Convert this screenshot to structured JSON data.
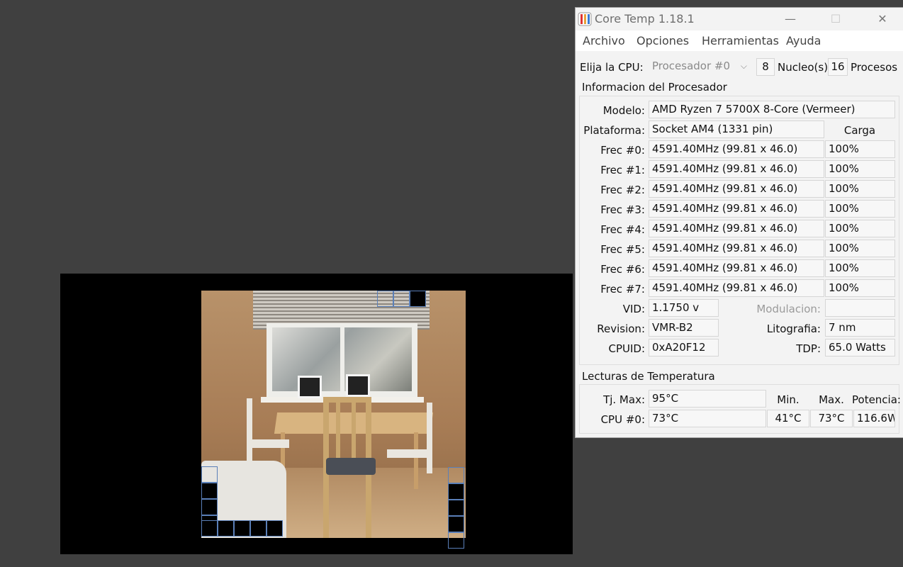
{
  "core_temp": {
    "title": "Core Temp 1.18.1",
    "window_controls": {
      "minimize": "—",
      "maximize": "☐",
      "close": "✕"
    },
    "menu": [
      "Archivo",
      "Opciones",
      "Herramientas",
      "Ayuda"
    ],
    "cpu_select": {
      "label": "Elija la CPU:",
      "selected": "Procesador #0",
      "cores_value": "8",
      "cores_label": "Nucleo(s)",
      "threads_value": "16",
      "threads_label": "Procesos"
    },
    "processor_info": {
      "section_title": "Informacion del Procesador",
      "model_label": "Modelo:",
      "model_value": "AMD Ryzen 7 5700X 8-Core (Vermeer)",
      "platform_label": "Plataforma:",
      "platform_value": "Socket AM4 (1331 pin)",
      "load_header": "Carga",
      "frequencies": [
        {
          "label": "Frec #0:",
          "value": "4591.40MHz (99.81 x 46.0)",
          "load": "100%"
        },
        {
          "label": "Frec #1:",
          "value": "4591.40MHz (99.81 x 46.0)",
          "load": "100%"
        },
        {
          "label": "Frec #2:",
          "value": "4591.40MHz (99.81 x 46.0)",
          "load": "100%"
        },
        {
          "label": "Frec #3:",
          "value": "4591.40MHz (99.81 x 46.0)",
          "load": "100%"
        },
        {
          "label": "Frec #4:",
          "value": "4591.40MHz (99.81 x 46.0)",
          "load": "100%"
        },
        {
          "label": "Frec #5:",
          "value": "4591.40MHz (99.81 x 46.0)",
          "load": "100%"
        },
        {
          "label": "Frec #6:",
          "value": "4591.40MHz (99.81 x 46.0)",
          "load": "100%"
        },
        {
          "label": "Frec #7:",
          "value": "4591.40MHz (99.81 x 46.0)",
          "load": "100%"
        }
      ],
      "vid_label": "VID:",
      "vid_value": "1.1750 v",
      "modulation_label": "Modulacion:",
      "modulation_value": "",
      "revision_label": "Revision:",
      "revision_value": "VMR-B2",
      "lithography_label": "Litografia:",
      "lithography_value": "7 nm",
      "cpuid_label": "CPUID:",
      "cpuid_value": "0xA20F12",
      "tdp_label": "TDP:",
      "tdp_value": "65.0 Watts"
    },
    "temperature": {
      "section_title": "Lecturas de Temperatura",
      "tjmax_label": "Tj. Max:",
      "tjmax_value": "95°C",
      "min_header": "Min.",
      "max_header": "Max.",
      "power_header": "Potencia:",
      "cpu0_label": "CPU #0:",
      "cpu0_value": "73°C",
      "cpu0_min": "41°C",
      "cpu0_max": "73°C",
      "cpu0_power": "116.6W"
    }
  },
  "colors": {
    "desktop": "#404040",
    "window_bg": "#f3f3f3",
    "field_bg": "#f7f7f7",
    "tile_border": "#5a7fb8"
  }
}
